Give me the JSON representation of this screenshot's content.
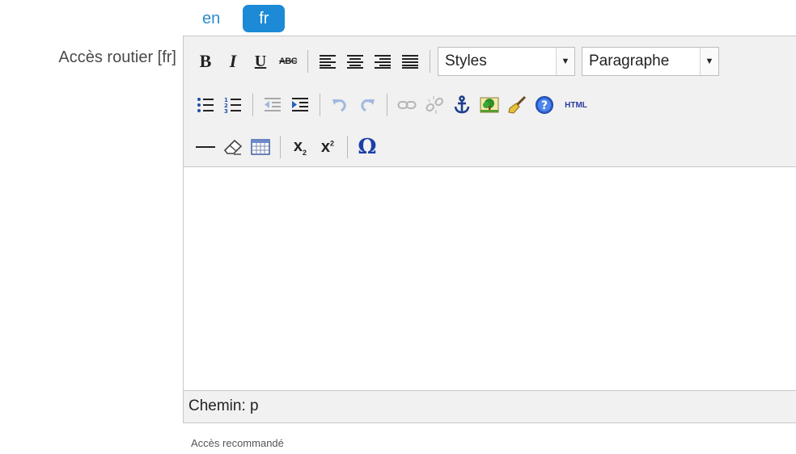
{
  "language_tabs": [
    {
      "label": "en",
      "active": false
    },
    {
      "label": "fr",
      "active": true
    }
  ],
  "field": {
    "label": "Accès routier [fr]",
    "help_text": "Accès recommandé"
  },
  "toolbar": {
    "bold_label": "B",
    "italic_label": "I",
    "underline_label": "U",
    "strikethrough_label": "ABC",
    "styles_select": "Styles",
    "format_select": "Paragraphe",
    "html_label": "HTML",
    "subscript_label": "x",
    "subscript_mark": "2",
    "superscript_label": "x",
    "superscript_mark": "2",
    "special_char_label": "Ω"
  },
  "status_bar": {
    "path": "Chemin: p"
  },
  "colors": {
    "accent": "#1c8ad6",
    "link": "#2a8ccc",
    "toolbar_bg": "#f1f1f1",
    "border": "#c8c8c8"
  },
  "icons": [
    "align-left-icon",
    "align-center-icon",
    "align-right-icon",
    "align-justify-icon",
    "bullet-list-icon",
    "numbered-list-icon",
    "outdent-icon",
    "indent-icon",
    "undo-icon",
    "redo-icon",
    "link-icon",
    "unlink-icon",
    "anchor-icon",
    "image-icon",
    "cleanup-icon",
    "help-icon",
    "horizontal-rule-icon",
    "eraser-icon",
    "table-icon"
  ]
}
